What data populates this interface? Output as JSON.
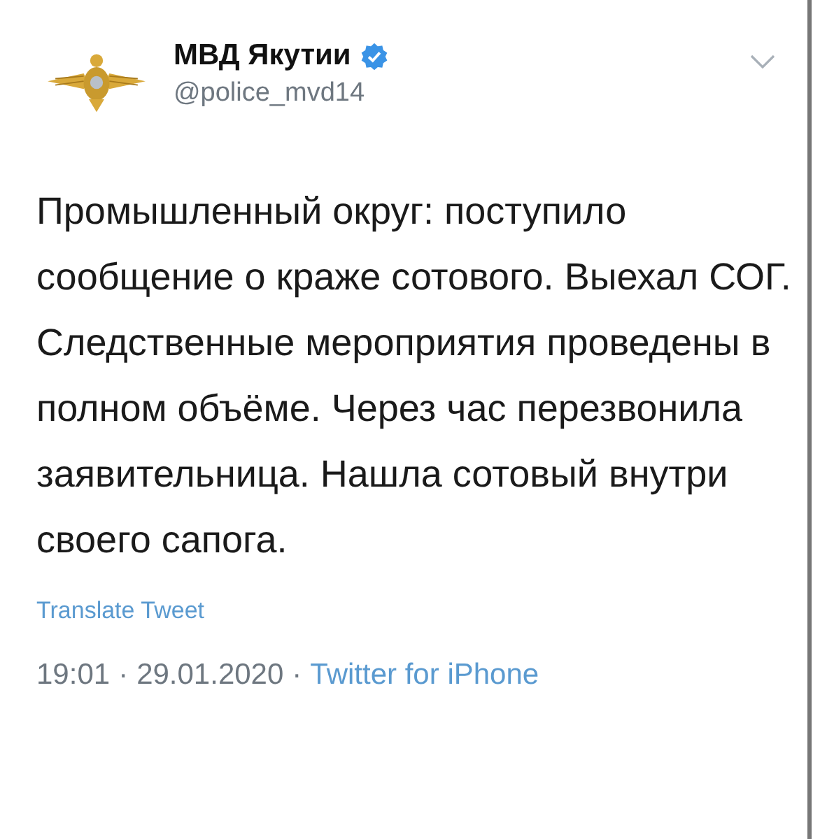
{
  "author": {
    "name": "МВД Якутии",
    "verified": true,
    "handle": "@police_mvd14"
  },
  "tweet": {
    "text": "Промышленный округ: поступило сообщение о краже сотового. Выехал СОГ. Следственные мероприятия проведены в полном объёме. Через час перезвонила заявительница. Нашла сотовый внутри своего сапога."
  },
  "translate": "Translate Tweet",
  "meta": {
    "time": "19:01",
    "date": "29.01.2020",
    "separator": "·",
    "source": "Twitter for iPhone"
  }
}
